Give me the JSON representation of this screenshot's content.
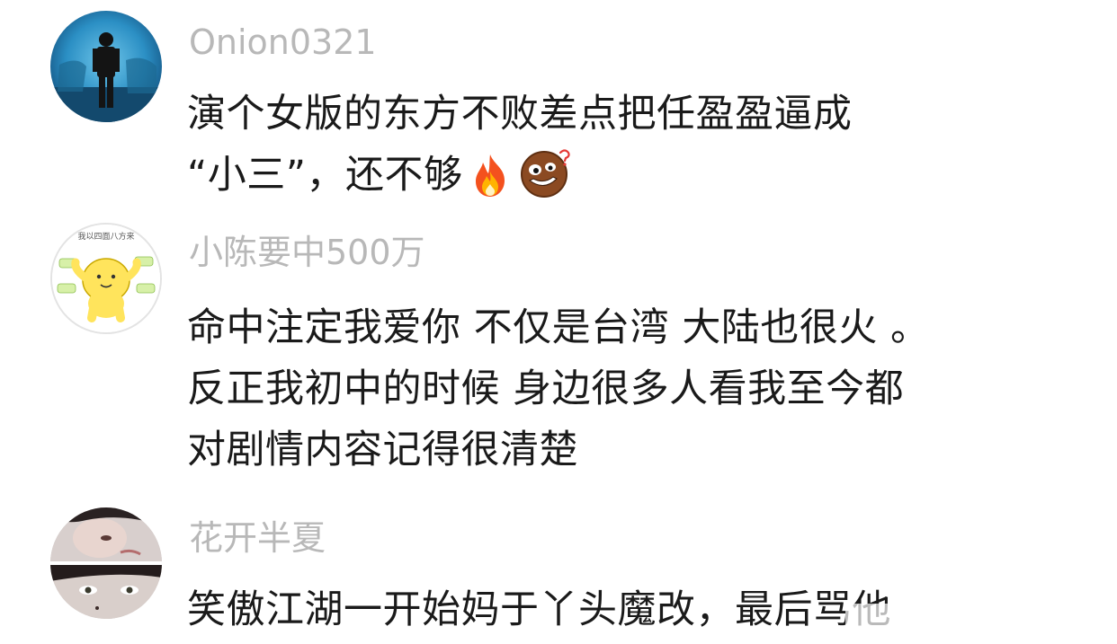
{
  "comments": [
    {
      "username": "Onion0321",
      "lines": [
        "演个女版的东方不败差点把任盈盈逼成",
        "“小三”，还不够"
      ],
      "emojis": [
        "fire-emoji",
        "confused-face-emoji"
      ]
    },
    {
      "username": "小陈要中500万",
      "avatar_text": "我以四面八方来",
      "lines": [
        "命中注定我爱你 不仅是台湾 大陆也很火 。",
        "反正我初中的时候 身边很多人看我至今都",
        "对剧情内容记得很清楚"
      ]
    },
    {
      "username": "花开半夏",
      "lines": [
        "笑傲江湖一开始妈于丫头魔改，最后骂他"
      ]
    }
  ],
  "colors": {
    "username": "#b8b8b8",
    "text": "#1a1a1a",
    "background": "#ffffff"
  }
}
